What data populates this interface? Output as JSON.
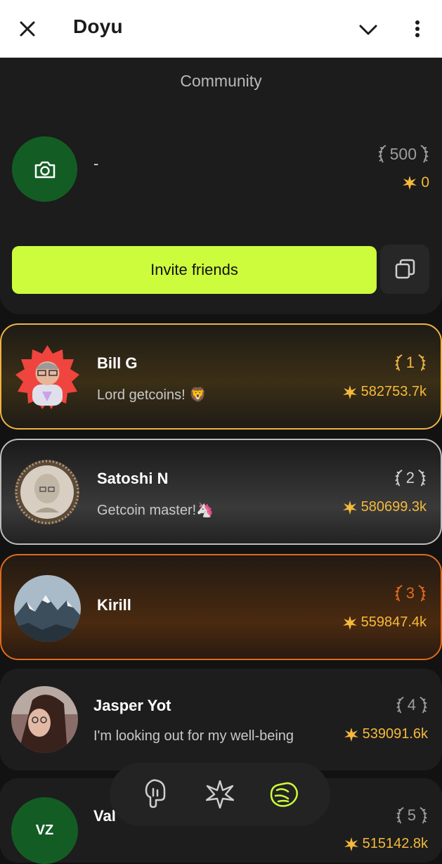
{
  "header": {
    "title": "Doyu"
  },
  "community": {
    "title": "Community",
    "name": "-",
    "rank": "500",
    "coins": "0",
    "invite_label": "Invite friends"
  },
  "leaderboard": [
    {
      "name": "Bill G",
      "status": "Lord getcoins! 🦁",
      "rank": "1",
      "coins": "582753.7k"
    },
    {
      "name": "Satoshi N",
      "status": "Getcoin master!🦄",
      "rank": "2",
      "coins": "580699.3k"
    },
    {
      "name": "Kirill",
      "status": "",
      "rank": "3",
      "coins": "559847.4k"
    },
    {
      "name": "Jasper Yot",
      "status": "I'm looking out for my well-being",
      "rank": "4",
      "coins": "539091.6k"
    },
    {
      "name": "Val",
      "initials": "VZ",
      "status": "",
      "rank": "5",
      "coins": "515142.8k"
    }
  ],
  "colors": {
    "accent": "#cdfc3c",
    "coin": "#f6b93b",
    "gold": "#f0b343",
    "silver": "#bdbdbd",
    "bronze": "#e06a1b",
    "community_avatar": "#135d24"
  },
  "icons": {
    "close": "close-icon",
    "chevron": "chevron-down-icon",
    "menu": "more-vertical-icon",
    "camera": "camera-icon",
    "copy": "copy-icon",
    "laurel": "laurel-icon",
    "coin": "burst-coin-icon",
    "nav": [
      "tap-hand-icon",
      "burst-icon",
      "handshake-icon"
    ]
  }
}
